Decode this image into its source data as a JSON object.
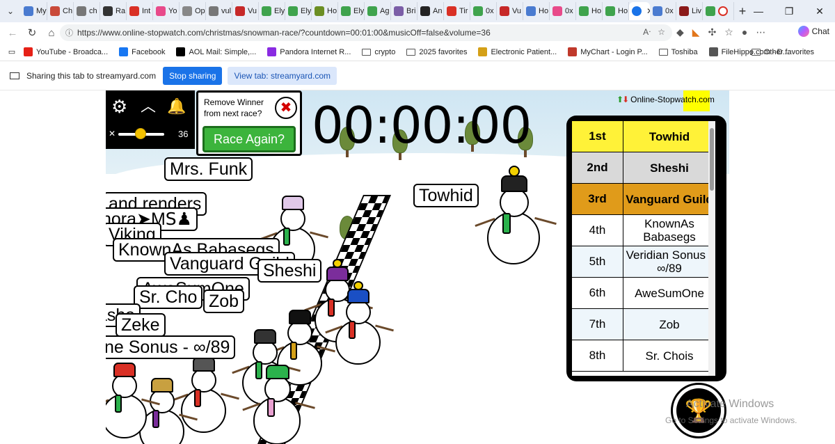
{
  "browser": {
    "tabs": [
      {
        "label": "My",
        "color": "#4a7bd0"
      },
      {
        "label": "Ch",
        "color": "#c94a3a"
      },
      {
        "label": "ch",
        "color": "#777777"
      },
      {
        "label": "Ra",
        "color": "#333333"
      },
      {
        "label": "Int",
        "color": "#d93025"
      },
      {
        "label": "Yo",
        "color": "#e84a8a"
      },
      {
        "label": "Op",
        "color": "#888888"
      },
      {
        "label": "vul",
        "color": "#777777"
      },
      {
        "label": "Vu",
        "color": "#c62828"
      },
      {
        "label": "Ely",
        "color": "#3fa34d"
      },
      {
        "label": "Ely",
        "color": "#3fa34d"
      },
      {
        "label": "Ho",
        "color": "#6b8e23"
      },
      {
        "label": "Ely",
        "color": "#3fa34d"
      },
      {
        "label": "Ag",
        "color": "#3fa34d"
      },
      {
        "label": "Bri",
        "color": "#7b5ea7"
      },
      {
        "label": "An",
        "color": "#222222"
      },
      {
        "label": "Tir",
        "color": "#d93025"
      },
      {
        "label": "0x",
        "color": "#3fa34d"
      },
      {
        "label": "Vu",
        "color": "#c62828"
      },
      {
        "label": "Ho",
        "color": "#4a7bd0"
      },
      {
        "label": "0x",
        "color": "#e84a8a"
      },
      {
        "label": "Ho",
        "color": "#3fa34d"
      },
      {
        "label": "Ho",
        "color": "#3fa34d"
      }
    ],
    "active_tab_label": "",
    "trailing_tabs": [
      {
        "label": "0x",
        "color": "#4a7bd0"
      },
      {
        "label": "Liv",
        "color": "#8b1a1a"
      }
    ],
    "url": "https://www.online-stopwatch.com/christmas/snowman-race/?countdown=00:01:00&musicOff=false&volume=36",
    "chat_label": "Chat"
  },
  "bookmarks": [
    {
      "label": "YouTube - Broadca...",
      "color": "#e62117",
      "kind": "icon"
    },
    {
      "label": "Facebook",
      "color": "#1877f2",
      "kind": "icon"
    },
    {
      "label": "AOL Mail: Simple,...",
      "color": "#000000",
      "kind": "icon"
    },
    {
      "label": "Pandora Internet R...",
      "color": "#8a2be2",
      "kind": "icon"
    },
    {
      "label": "crypto",
      "color": "",
      "kind": "folder"
    },
    {
      "label": "2025 favorites",
      "color": "",
      "kind": "folder"
    },
    {
      "label": "Electronic Patient...",
      "color": "#d4a017",
      "kind": "icon"
    },
    {
      "label": "MyChart - Login P...",
      "color": "#c0392b",
      "kind": "icon"
    },
    {
      "label": "Toshiba",
      "color": "",
      "kind": "folder"
    },
    {
      "label": "FileHippo.com - D...",
      "color": "#555555",
      "kind": "icon"
    }
  ],
  "bookmarks_other": "Other favorites",
  "sharebar": {
    "text": "Sharing this tab to streamyard.com",
    "stop_label": "Stop sharing",
    "view_label": "View tab: streamyard.com"
  },
  "game": {
    "brand": "Online-Stopwatch.com",
    "timer": "00:00:00",
    "volume": "36",
    "volume_level": 0.36,
    "remove_winner_text_1": "Remove Winner",
    "remove_winner_text_2": "from next race?",
    "race_again_label": "Race Again?",
    "labels": [
      {
        "text": "Mrs. Funk"
      },
      {
        "text": "and renders"
      },
      {
        "text": "nora➤MS‍♟"
      },
      {
        "text": "Viking"
      },
      {
        "text": "KnownAs Babasegs"
      },
      {
        "text": "Vanguard Guild"
      },
      {
        "text": "Sheshi"
      },
      {
        "text": "AweSumOne"
      },
      {
        "text": "Sr. Cho"
      },
      {
        "text": "Zob"
      },
      {
        "text": "asha"
      },
      {
        "text": "Zeke"
      },
      {
        "text": "ne Sonus - ∞/89"
      },
      {
        "text": "Towhid"
      }
    ],
    "results": [
      {
        "place": "1st",
        "name": "Towhid",
        "bg": "#fff238"
      },
      {
        "place": "2nd",
        "name": "Sheshi",
        "bg": "#d9d9d9"
      },
      {
        "place": "3rd",
        "name": "Vanguard Guild",
        "bg": "#e09b1a"
      },
      {
        "place": "4th",
        "name": "KnownAs Babasegs",
        "bg": "#ffffff"
      },
      {
        "place": "5th",
        "name": "Veridian Sonus - ∞/89",
        "bg": "#eef6fb"
      },
      {
        "place": "6th",
        "name": "AweSumOne",
        "bg": "#ffffff"
      },
      {
        "place": "7th",
        "name": "Zob",
        "bg": "#eef6fb"
      },
      {
        "place": "8th",
        "name": "Sr. Chois",
        "bg": "#ffffff"
      }
    ]
  },
  "watermark": {
    "line1": "Activate Windows",
    "line2": "Go to Settings to activate Windows."
  }
}
